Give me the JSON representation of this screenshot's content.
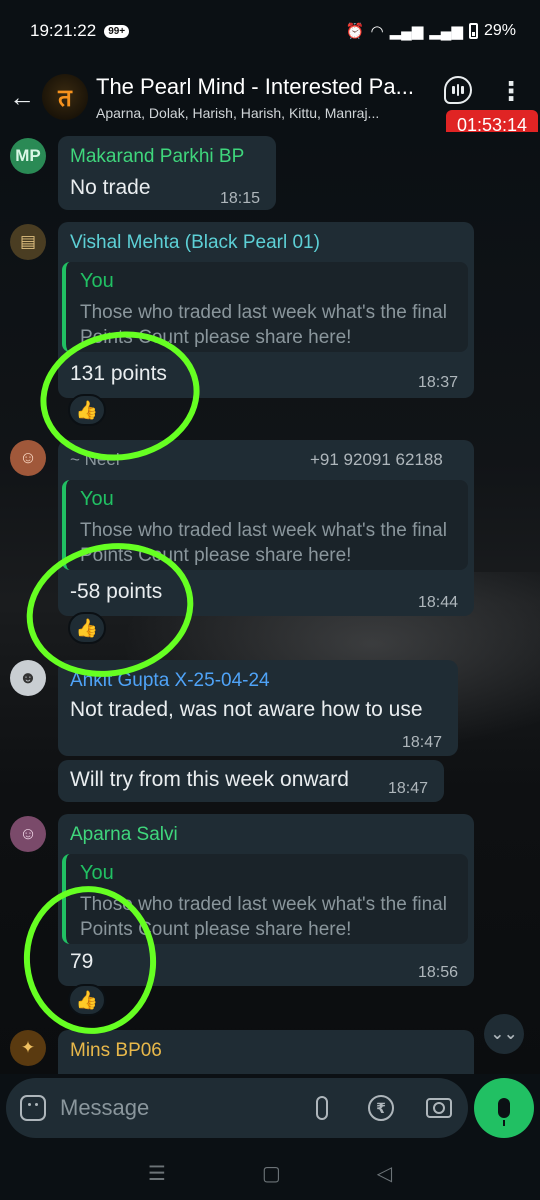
{
  "status_bar": {
    "time": "19:21:22",
    "notif_badge": "99+",
    "battery": "29%"
  },
  "header": {
    "title": "The Pearl Mind - Interested Pa...",
    "subtitle": "Aparna, Dolak, Harish, Harish, Kittu, Manraj...",
    "group_initial": "त",
    "call_timer": "01:53:14",
    "icons": [
      "back-arrow-icon",
      "voice-call-icon",
      "more-options-icon"
    ]
  },
  "colors": {
    "accent_green": "#21c063",
    "bubble": "#1f2c34",
    "timer_red": "#e02424",
    "highlight_circle": "#66ff22"
  },
  "messages": [
    {
      "avatar_text": "MP",
      "sender": "Makarand Parkhi BP",
      "sender_color": "#3fd67c",
      "text": "No trade",
      "time": "18:15"
    },
    {
      "sender": "Vishal Mehta (Black Pearl 01)",
      "sender_color": "#5dd0d6",
      "quote_author": "You",
      "quote_text": "Those who traded last week what's the final Points Count please share here!",
      "text": "131 points",
      "time": "18:37",
      "reaction": "👍"
    },
    {
      "sender": "~ Neel",
      "sender_color": "#8a969c",
      "phone": "+91 92091 62188",
      "quote_author": "You",
      "quote_text": "Those who traded last week what's the final Points Count please share here!",
      "text": "-58 points",
      "time": "18:44",
      "reaction": "👍"
    },
    {
      "sender": "Ankit Gupta X-25-04-24",
      "sender_color": "#4fa3f7",
      "text": "Not traded, was not aware how to use",
      "time": "18:47",
      "followup_text": "Will try from this week onward",
      "followup_time": "18:47"
    },
    {
      "sender": "Aparna Salvi",
      "sender_color": "#3fd67c",
      "quote_author": "You",
      "quote_text": "Those who traded last week what's the final Points Count please share here!",
      "text": "79",
      "time": "18:56",
      "reaction": "👍"
    },
    {
      "sender": "Mins BP06",
      "sender_color": "#e8b84a"
    }
  ],
  "composer": {
    "placeholder": "Message",
    "icons": [
      "emoji-icon",
      "attach-icon",
      "rupee-payment-icon",
      "camera-icon",
      "mic-icon"
    ]
  }
}
